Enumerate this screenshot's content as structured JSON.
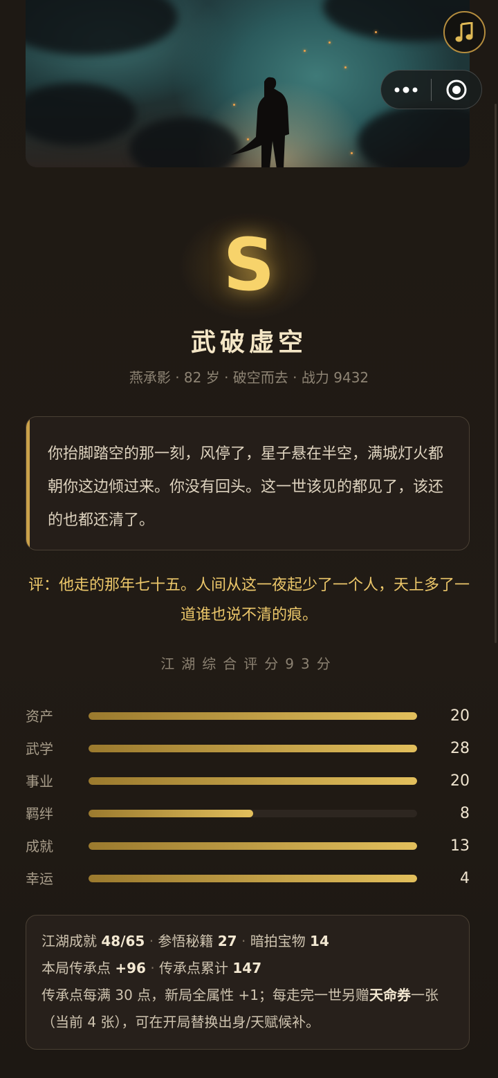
{
  "grade": "S",
  "title": "武破虚空",
  "subtitle": "燕承影 · 82 岁 · 破空而去 · 战力 9432",
  "story": "你抬脚踏空的那一刻，风停了，星子悬在半空，满城灯火都朝你这边倾过来。你没有回头。这一世该见的都见了，该还的也都还清了。",
  "comment": "评：他走的那年七十五。人间从这一夜起少了一个人，天上多了一道谁也说不清的痕。",
  "score_title": "江湖综合评分93分",
  "stats": [
    {
      "label": "资产",
      "value": "20",
      "fill": 1.0
    },
    {
      "label": "武学",
      "value": "28",
      "fill": 1.0
    },
    {
      "label": "事业",
      "value": "20",
      "fill": 1.0
    },
    {
      "label": "羁绊",
      "value": "8",
      "fill": 0.5
    },
    {
      "label": "成就",
      "value": "13",
      "fill": 1.0
    },
    {
      "label": "幸运",
      "value": "4",
      "fill": 1.0
    }
  ],
  "info": {
    "achievement_label": "江湖成就",
    "achievement_value": "48/65",
    "manual_label": "参悟秘籍",
    "manual_value": "27",
    "treasure_label": "暗拍宝物",
    "treasure_value": "14",
    "points_label": "本局传承点",
    "points_value": "+96",
    "total_label": "传承点累计",
    "total_value": "147",
    "rule_text_a": "传承点每满 30 点，新局全属性 +1；每走完一世另赠",
    "rule_highlight": "天命券",
    "rule_text_b": "一张（当前 4 张），可在开局替换出身/天赋候补。"
  },
  "icons": {
    "music": "music-note-icon",
    "more": "more-dots-icon",
    "close": "target-circle-icon"
  },
  "colors": {
    "gold": "#f7d36b",
    "background": "#1f1a15",
    "accent_bar": "#caa14a"
  }
}
